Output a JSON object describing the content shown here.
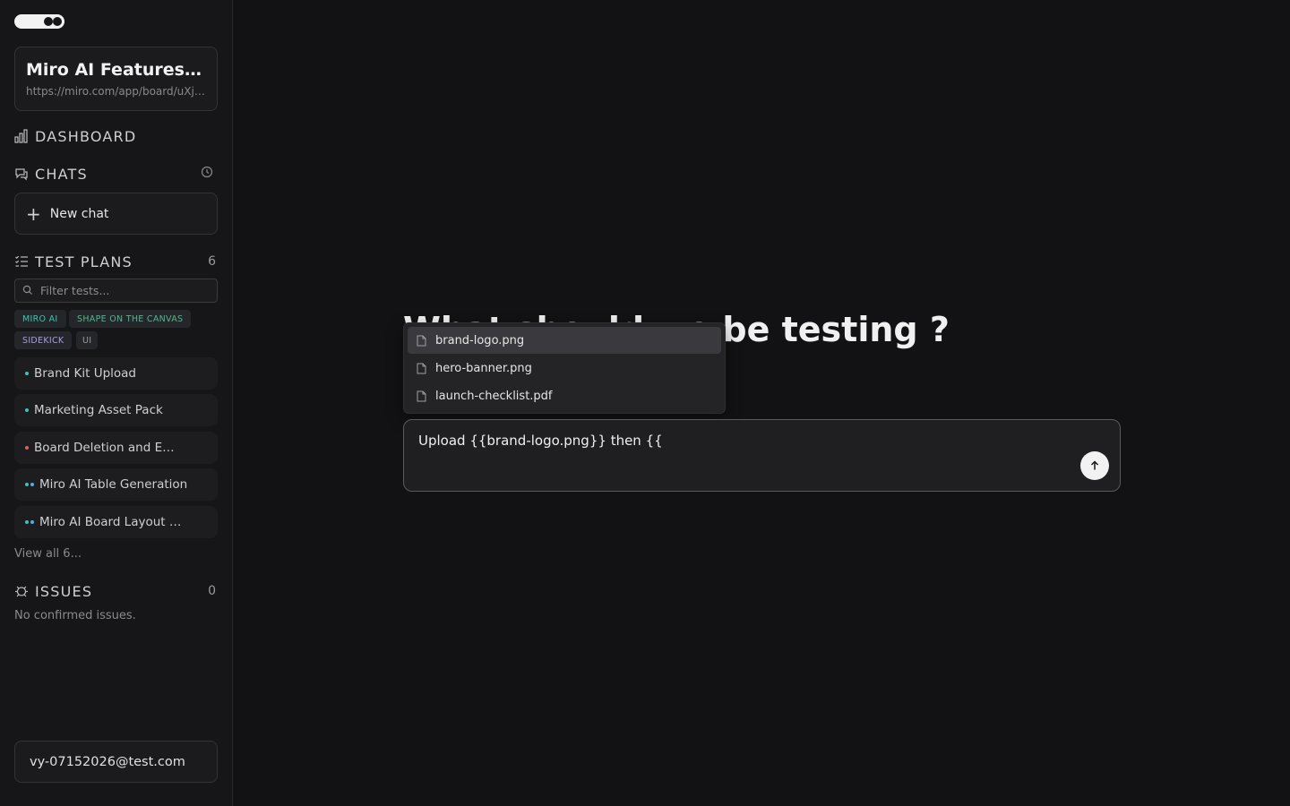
{
  "sidebar": {
    "board": {
      "title": "Miro AI Features Regression",
      "url": "https://miro.com/app/board/uXjVJ-example="
    },
    "dashboard_label": "DASHBOARD",
    "chats_label": "CHATS",
    "new_chat_label": "New chat",
    "test_plans_label": "TEST PLANS",
    "test_plans_count": "6",
    "filter_placeholder": "Filter tests...",
    "tags": [
      {
        "label": "MIRO AI",
        "color": "#3bc6b0"
      },
      {
        "label": "SHAPE ON THE CANVAS",
        "color": "#4fb98a"
      },
      {
        "label": "SIDEKICK",
        "color": "#a99ce0"
      },
      {
        "label": "UI",
        "color": "#9a9a9e"
      }
    ],
    "tests": [
      {
        "label": "Brand Kit Upload",
        "dots": [
          "#3bc6b0"
        ]
      },
      {
        "label": "Marketing Asset Pack",
        "dots": [
          "#3bc6b0"
        ]
      },
      {
        "label": "Board Deletion and Empty State",
        "dots": [
          "#e0605e"
        ]
      },
      {
        "label": "Miro AI Table Generation",
        "dots": [
          "#3bc6b0",
          "#5aa9e6"
        ]
      },
      {
        "label": "Miro AI Board Layout Generation",
        "dots": [
          "#3bc6b0",
          "#5aa9e6"
        ]
      }
    ],
    "view_all_label": "View all 6...",
    "issues_label": "ISSUES",
    "issues_count": "0",
    "no_issues_label": "No confirmed issues.",
    "user_email": "vy-07152026@test.com"
  },
  "main": {
    "heading": "What should we be testing ?",
    "dropdown": [
      {
        "label": "brand-logo.png",
        "icon": "file-icon"
      },
      {
        "label": "hero-banner.png",
        "icon": "file-icon"
      },
      {
        "label": "launch-checklist.pdf",
        "icon": "file-icon"
      }
    ],
    "composer_text": "Upload {{brand-logo.png}} then {{",
    "send_icon": "arrow-up-icon"
  }
}
